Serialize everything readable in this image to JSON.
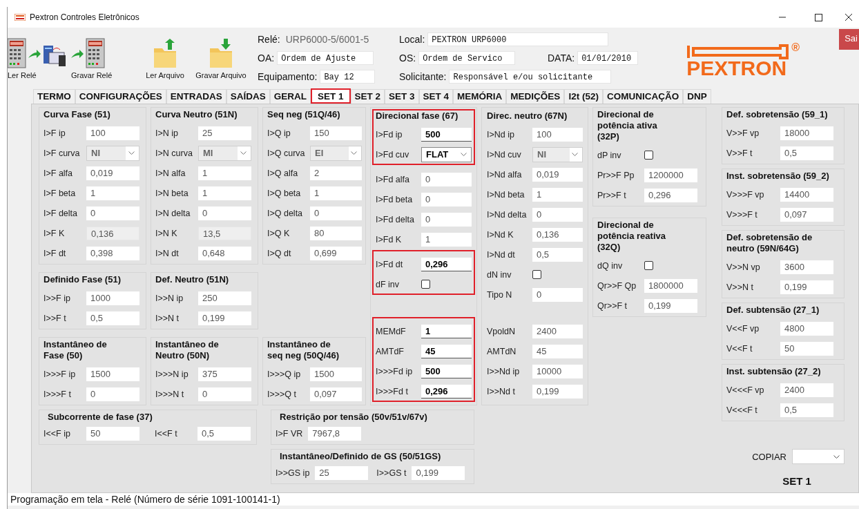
{
  "window": {
    "title": "Pextron Controles Eletrônicos"
  },
  "toolbar": [
    {
      "label": "Ler Relé",
      "kind": "read-relay"
    },
    {
      "label": "Gravar Relé",
      "kind": "write-relay"
    },
    {
      "label": "Ler Arquivo",
      "kind": "open-file"
    },
    {
      "label": "Gravar Arquivo",
      "kind": "save-file"
    }
  ],
  "header": [
    [
      {
        "label": "Relé:",
        "value": "URP6000-5/6001-5",
        "kind": "text"
      },
      {
        "label": "Local:",
        "value": "PEXTRON URP6000",
        "kind": "field"
      }
    ],
    [
      {
        "label": "OA:",
        "value": "Ordem de Ajuste",
        "kind": "field"
      },
      {
        "label": "OS:",
        "value": "Ordem de Servico",
        "kind": "field"
      },
      {
        "label": "DATA:",
        "value": "01/01/2010",
        "kind": "field"
      }
    ],
    [
      {
        "label": "Equipamento:",
        "value": "Bay 12",
        "kind": "field"
      },
      {
        "label": "Solicitante:",
        "value": "Responsável e/ou solicitante",
        "kind": "field"
      }
    ]
  ],
  "logo": {
    "text": "PEXTRON",
    "mark": "®"
  },
  "exit_button": "Sai",
  "tabs": [
    {
      "label": "TERMO",
      "selected": false
    },
    {
      "label": "CONFIGURAÇÕES",
      "selected": false
    },
    {
      "label": "ENTRADAS",
      "selected": false
    },
    {
      "label": "SAÍDAS",
      "selected": false
    },
    {
      "label": "GERAL",
      "selected": false
    },
    {
      "label": "SET 1",
      "selected": true
    },
    {
      "label": "SET 2",
      "selected": false
    },
    {
      "label": "SET 3",
      "selected": false
    },
    {
      "label": "SET 4",
      "selected": false
    },
    {
      "label": "MEMÓRIA",
      "selected": false
    },
    {
      "label": "MEDIÇÕES",
      "selected": false
    },
    {
      "label": "I2t (52)",
      "selected": false
    },
    {
      "label": "COMUNICAÇÃO",
      "selected": false
    },
    {
      "label": "DNP",
      "selected": false
    }
  ],
  "columns": [
    [
      {
        "title": "Curva Fase (51)",
        "rows": [
          {
            "label": "I>F ip",
            "kind": "text",
            "value": "100",
            "disabled": false
          },
          {
            "label": "I>F curva",
            "kind": "combo",
            "value": "NI",
            "disabled": true
          },
          {
            "label": "I>F alfa",
            "kind": "text",
            "value": "0,019",
            "disabled": false
          },
          {
            "label": "I>F beta",
            "kind": "text",
            "value": "1",
            "disabled": false
          },
          {
            "label": "I>F delta",
            "kind": "text",
            "value": "0",
            "disabled": false
          },
          {
            "label": "I>F K",
            "kind": "text",
            "value": "0,136",
            "disabled": true
          },
          {
            "label": "I>F dt",
            "kind": "text",
            "value": "0,398",
            "disabled": false
          }
        ]
      },
      {
        "title": "Definido Fase (51)",
        "rows": [
          {
            "label": "I>>F ip",
            "kind": "text",
            "value": "1000",
            "disabled": false
          },
          {
            "label": "I>>F t",
            "kind": "text",
            "value": "0,5",
            "disabled": false
          }
        ]
      },
      {
        "title": "Instantâneo de\nFase (50)",
        "rows": [
          {
            "label": "I>>>F ip",
            "kind": "text",
            "value": "1500",
            "disabled": false
          },
          {
            "label": "I>>>F t",
            "kind": "text",
            "value": "0",
            "disabled": false
          }
        ]
      }
    ],
    [
      {
        "title": "Curva Neutro (51N)",
        "rows": [
          {
            "label": "I>N ip",
            "kind": "text",
            "value": "25",
            "disabled": false
          },
          {
            "label": "I>N curva",
            "kind": "combo",
            "value": "MI",
            "disabled": true
          },
          {
            "label": "I>N alfa",
            "kind": "text",
            "value": "1",
            "disabled": false
          },
          {
            "label": "I>N beta",
            "kind": "text",
            "value": "1",
            "disabled": false
          },
          {
            "label": "I>N delta",
            "kind": "text",
            "value": "0",
            "disabled": false
          },
          {
            "label": "I>N K",
            "kind": "text",
            "value": "13,5",
            "disabled": true
          },
          {
            "label": "I>N dt",
            "kind": "text",
            "value": "0,648",
            "disabled": false
          }
        ]
      },
      {
        "title": "Def. Neutro (51N)",
        "rows": [
          {
            "label": "I>>N ip",
            "kind": "text",
            "value": "250",
            "disabled": false
          },
          {
            "label": "I>>N t",
            "kind": "text",
            "value": "0,199",
            "disabled": false
          }
        ]
      },
      {
        "title": "Instantâneo de\nNeutro (50N)",
        "rows": [
          {
            "label": "I>>>N ip",
            "kind": "text",
            "value": "375",
            "disabled": false
          },
          {
            "label": "I>>>N t",
            "kind": "text",
            "value": "0",
            "disabled": false
          }
        ]
      }
    ],
    [
      {
        "title": "Seq neg (51Q/46)",
        "rows": [
          {
            "label": "I>Q ip",
            "kind": "text",
            "value": "150",
            "disabled": false
          },
          {
            "label": "I>Q curva",
            "kind": "combo",
            "value": "EI",
            "disabled": true
          },
          {
            "label": "I>Q alfa",
            "kind": "text",
            "value": "2",
            "disabled": false
          },
          {
            "label": "I>Q beta",
            "kind": "text",
            "value": "1",
            "disabled": false
          },
          {
            "label": "I>Q delta",
            "kind": "text",
            "value": "0",
            "disabled": false
          },
          {
            "label": "I>Q K",
            "kind": "text",
            "value": "80",
            "disabled": false
          },
          {
            "label": "I>Q dt",
            "kind": "text",
            "value": "0,699",
            "disabled": false
          }
        ]
      },
      {
        "title": "Instantâneo de\nseq neg (50Q/46)",
        "rows": [
          {
            "label": "I>>>Q ip",
            "kind": "text",
            "value": "1500",
            "disabled": false
          },
          {
            "label": "I>>>Q t",
            "kind": "text",
            "value": "0,097",
            "disabled": false
          }
        ]
      }
    ],
    [
      {
        "title": "Direcional fase (67)",
        "sections": [
          {
            "highlighted": true,
            "rows": [
              {
                "label": "I>Fd ip",
                "kind": "text",
                "value": "500",
                "disabled": false
              },
              {
                "label": "I>Fd cuv",
                "kind": "combo",
                "value": "FLAT",
                "disabled": false
              }
            ]
          },
          {
            "highlighted": false,
            "rows": [
              {
                "label": "I>Fd alfa",
                "kind": "text",
                "value": "0",
                "disabled": false
              },
              {
                "label": "I>Fd beta",
                "kind": "text",
                "value": "0",
                "disabled": false
              },
              {
                "label": "I>Fd delta",
                "kind": "text",
                "value": "0",
                "disabled": false
              },
              {
                "label": "I>Fd K",
                "kind": "text",
                "value": "1",
                "disabled": false
              }
            ]
          },
          {
            "highlighted": true,
            "rows": [
              {
                "label": "I>Fd dt",
                "kind": "text",
                "value": "0,296",
                "disabled": false
              },
              {
                "label": "dF inv",
                "kind": "checkbox",
                "checked": false
              }
            ]
          },
          {
            "highlighted": true,
            "rows": [
              {
                "label": "MEMdF",
                "kind": "text",
                "value": "1",
                "disabled": false
              },
              {
                "label": "AMTdF",
                "kind": "text",
                "value": "45",
                "disabled": false
              },
              {
                "label": "I>>>Fd ip",
                "kind": "text",
                "value": "500",
                "disabled": false
              },
              {
                "label": "I>>>Fd t",
                "kind": "text",
                "value": "0,296",
                "disabled": false
              }
            ]
          }
        ]
      }
    ],
    [
      {
        "title": "Direc. neutro (67N)",
        "sections": [
          {
            "highlighted": false,
            "rows": [
              {
                "label": "I>Nd ip",
                "kind": "text",
                "value": "100",
                "disabled": false
              },
              {
                "label": "I>Nd cuv",
                "kind": "combo",
                "value": "NI",
                "disabled": true
              },
              {
                "label": "I>Nd alfa",
                "kind": "text",
                "value": "0,019",
                "disabled": false
              },
              {
                "label": "I>Nd beta",
                "kind": "text",
                "value": "1",
                "disabled": false
              },
              {
                "label": "I>Nd delta",
                "kind": "text",
                "value": "0",
                "disabled": false
              },
              {
                "label": "I>Nd K",
                "kind": "text",
                "value": "0,136",
                "disabled": false
              },
              {
                "label": "I>Nd dt",
                "kind": "text",
                "value": "0,5",
                "disabled": false
              },
              {
                "label": "dN inv",
                "kind": "checkbox",
                "checked": false
              },
              {
                "label": "Tipo N",
                "kind": "text",
                "value": "0",
                "disabled": false
              }
            ]
          },
          {
            "highlighted": false,
            "rows": [
              {
                "label": "VpoldN",
                "kind": "text",
                "value": "2400",
                "disabled": false
              },
              {
                "label": "AMTdN",
                "kind": "text",
                "value": "45",
                "disabled": false
              },
              {
                "label": "I>>Nd ip",
                "kind": "text",
                "value": "10000",
                "disabled": false
              },
              {
                "label": "I>>Nd t",
                "kind": "text",
                "value": "0,199",
                "disabled": false
              }
            ]
          }
        ]
      }
    ],
    [
      {
        "title": "Direcional de\npotência ativa\n(32P)",
        "rows": [
          {
            "label": "dP inv",
            "kind": "checkbox",
            "checked": false
          },
          {
            "label": "Pr>>F Pp",
            "kind": "text",
            "value": "1200000",
            "disabled": false
          },
          {
            "label": "Pr>>F t",
            "kind": "text",
            "value": "0,296",
            "disabled": false
          }
        ]
      },
      {
        "title": "Direcional de\npotência reativa\n(32Q)",
        "rows": [
          {
            "label": "dQ inv",
            "kind": "checkbox",
            "checked": false
          },
          {
            "label": "Qr>>F Qp",
            "kind": "text",
            "value": "1800000",
            "disabled": false
          },
          {
            "label": "Qr>>F t",
            "kind": "text",
            "value": "0,199",
            "disabled": false
          }
        ]
      }
    ]
  ],
  "bottom": [
    [
      {
        "title": "Subcorrente de fase (37)",
        "rows": [
          {
            "label": "I<<F ip",
            "kind": "text",
            "value": "50",
            "disabled": false
          },
          {
            "label": "I<<F t",
            "kind": "text",
            "value": "0,5",
            "disabled": false
          }
        ]
      }
    ],
    [
      {
        "title": "Restrição por tensão (50v/51v/67v)",
        "rows": [
          {
            "label": "I>F VR",
            "kind": "text",
            "value": "7967,8",
            "disabled": false
          }
        ]
      },
      {
        "title": "Instantâneo/Definido de GS (50/51GS)",
        "rows": [
          {
            "label": "I>>GS ip",
            "kind": "text",
            "value": "25",
            "disabled": false
          },
          {
            "label": "I>>GS t",
            "kind": "text",
            "value": "0,199",
            "disabled": false
          }
        ]
      }
    ]
  ],
  "right_column": [
    {
      "title": "Def. sobretensão (59_1)",
      "rows": [
        {
          "label": "V>>F vp",
          "kind": "text",
          "value": "18000",
          "disabled": false
        },
        {
          "label": "V>>F t",
          "kind": "text",
          "value": "0,5",
          "disabled": false
        }
      ]
    },
    {
      "title": "Inst. sobretensão (59_2)",
      "rows": [
        {
          "label": "V>>>F vp",
          "kind": "text",
          "value": "14400",
          "disabled": false
        },
        {
          "label": "V>>>F t",
          "kind": "text",
          "value": "0,097",
          "disabled": false
        }
      ]
    },
    {
      "title": "Def. sobretensão de\nneutro (59N/64G)",
      "rows": [
        {
          "label": "V>>N vp",
          "kind": "text",
          "value": "3600",
          "disabled": false
        },
        {
          "label": "V>>N t",
          "kind": "text",
          "value": "0,199",
          "disabled": false
        }
      ]
    },
    {
      "title": "Def. subtensão (27_1)",
      "rows": [
        {
          "label": "V<<F vp",
          "kind": "text",
          "value": "4800",
          "disabled": false
        },
        {
          "label": "V<<F t",
          "kind": "text",
          "value": "50",
          "disabled": false
        }
      ]
    },
    {
      "title": "Inst. subtensão (27_2)",
      "rows": [
        {
          "label": "V<<<F vp",
          "kind": "text",
          "value": "2400",
          "disabled": false
        },
        {
          "label": "V<<<F t",
          "kind": "text",
          "value": "0,5",
          "disabled": false
        }
      ]
    }
  ],
  "copy": {
    "label": "COPIAR"
  },
  "set_label": "SET 1",
  "status_bar": "Programação em tela - Relé (Número de série 1091-100141-1)"
}
